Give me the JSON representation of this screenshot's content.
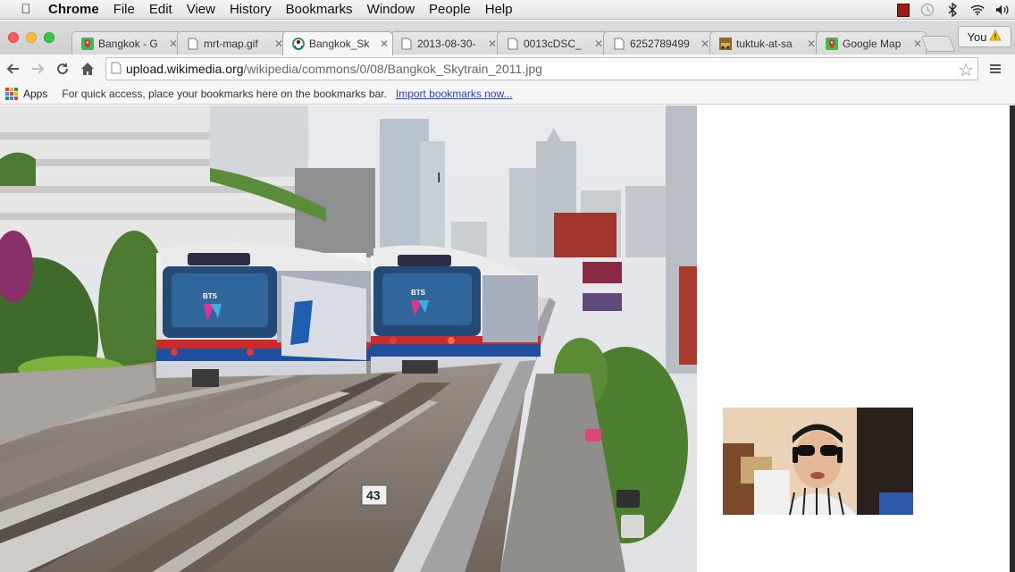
{
  "menubar": {
    "app": "Chrome",
    "items": [
      "File",
      "Edit",
      "View",
      "History",
      "Bookmarks",
      "Window",
      "People",
      "Help"
    ],
    "tray_icons": [
      "recording-icon",
      "clock-icon",
      "bluetooth-icon",
      "wifi-icon",
      "volume-icon"
    ]
  },
  "tabs": [
    {
      "title": "Bangkok - G",
      "icon": "google-maps-icon",
      "active": false
    },
    {
      "title": "mrt-map.gif",
      "icon": "page-icon",
      "active": false
    },
    {
      "title": "Bangkok_Sk",
      "icon": "wikimedia-icon",
      "active": true
    },
    {
      "title": "2013-08-30-",
      "icon": "page-icon",
      "active": false
    },
    {
      "title": "0013cDSC_",
      "icon": "page-icon",
      "active": false
    },
    {
      "title": "6252789499",
      "icon": "page-icon",
      "active": false
    },
    {
      "title": "tuktuk-at-sa",
      "icon": "image-icon",
      "active": false
    },
    {
      "title": "Google Map",
      "icon": "google-maps-icon",
      "active": false
    }
  ],
  "profile": {
    "label": "You",
    "icon": "warning-icon"
  },
  "omnibox": {
    "host": "upload.wikimedia.org",
    "path": "/wikipedia/commons/0/08/Bangkok_Skytrain_2011.jpg"
  },
  "bookmarks": {
    "apps_label": "Apps",
    "hint": "For quick access, place your bookmarks here on the bookmarks bar.",
    "import_link": "Import bookmarks now..."
  },
  "photo": {
    "alt": "Bangkok_Skytrain_2011.jpg",
    "train_logo": "BTS",
    "track_number": "43"
  },
  "colors": {
    "tab_strip": "#d5d5d5",
    "toolbar": "#f6f6f6",
    "link": "#2a3bd6",
    "traffic_red": "#fc605c",
    "traffic_yellow": "#fdbc40",
    "traffic_green": "#34c84a"
  }
}
